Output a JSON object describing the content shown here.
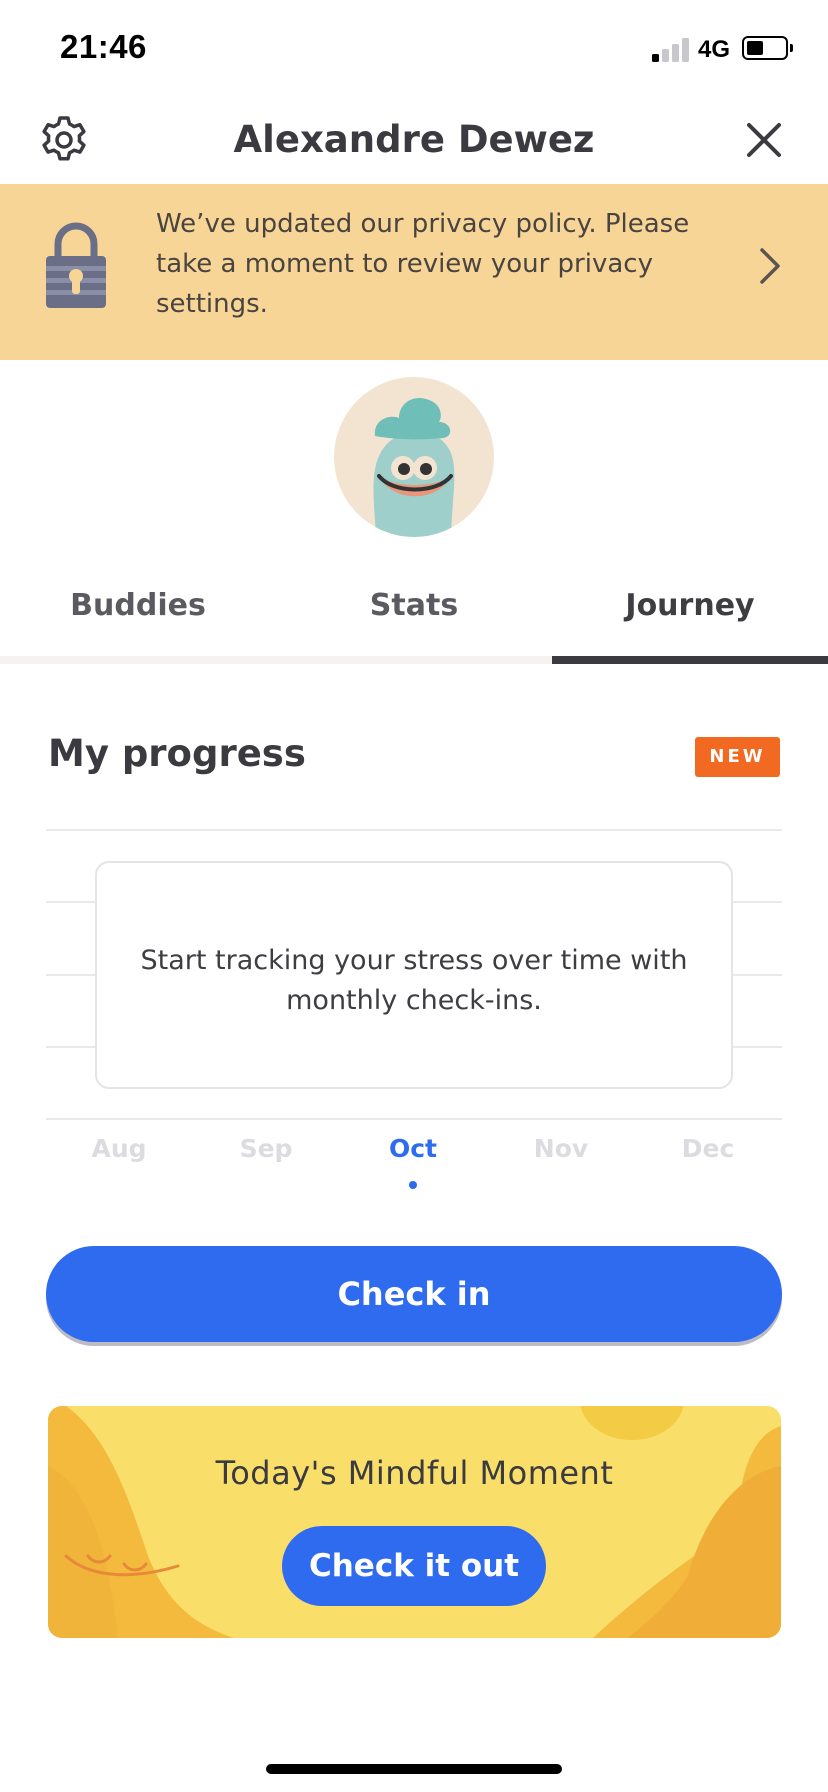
{
  "status_bar": {
    "time": "21:46",
    "network": "4G",
    "signal_bars_active": 1,
    "signal_bars_total": 4,
    "battery_level": 0.4
  },
  "header": {
    "title": "Alexandre Dewez",
    "settings_icon": "gear-icon",
    "close_icon": "close-icon"
  },
  "privacy_banner": {
    "text": "We’ve updated our privacy policy. Please take a moment to review your privacy settings.",
    "icon": "lock-icon",
    "chevron_icon": "chevron-right-icon",
    "background": "#f7d597"
  },
  "tabs": {
    "items": [
      {
        "label": "Buddies"
      },
      {
        "label": "Stats"
      },
      {
        "label": "Journey"
      }
    ],
    "active": "Journey"
  },
  "progress": {
    "title": "My progress",
    "badge": "NEW",
    "badge_color": "#f26a22",
    "empty_message": "Start tracking your stress over time with monthly check-ins.",
    "months": [
      {
        "label": "Aug"
      },
      {
        "label": "Sep"
      },
      {
        "label": "Oct"
      },
      {
        "label": "Nov"
      },
      {
        "label": "Dec"
      }
    ],
    "active_month": "Oct"
  },
  "checkin": {
    "label": "Check in",
    "color": "#2f6bef"
  },
  "mindful_moment": {
    "title": "Today's Mindful Moment",
    "button_label": "Check it out",
    "background": "#f9de6a"
  }
}
